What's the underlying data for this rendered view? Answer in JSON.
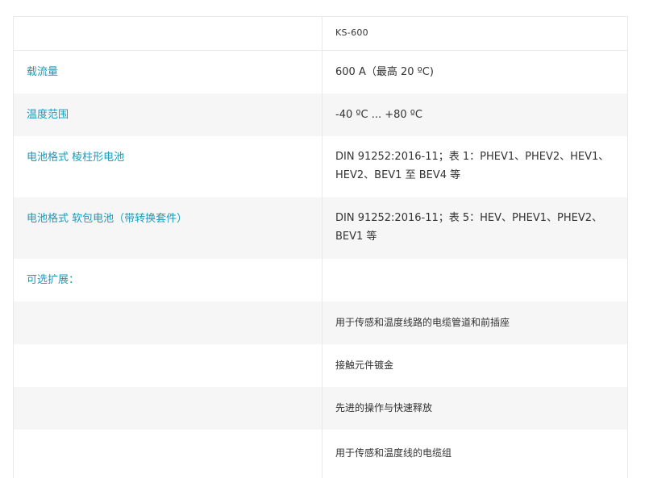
{
  "header": {
    "label": "",
    "value": "KS-600"
  },
  "rows": [
    {
      "label": "载流量",
      "value": "600 A（最高 20 ºC)"
    },
    {
      "label": "温度范围",
      "value": "-40 ºC ... +80 ºC"
    },
    {
      "label": "电池格式 棱柱形电池",
      "value": "DIN 91252:2016-11；表 1：PHEV1、PHEV2、HEV1、HEV2、BEV1 至 BEV4 等"
    },
    {
      "label": "电池格式 软包电池（带转换套件）",
      "value": "DIN 91252:2016-11；表 5：HEV、PHEV1、PHEV2、BEV1 等"
    },
    {
      "label": "可选扩展：",
      "value": ""
    },
    {
      "label": "",
      "value": "用于传感和温度线路的电缆管道和前插座"
    },
    {
      "label": "",
      "value": "接触元件镀金"
    },
    {
      "label": "",
      "value": "先进的操作与快速释放"
    },
    {
      "label": "",
      "value": "用于传感和温度线的电缆组"
    }
  ],
  "colors": {
    "label": "#1a9bb8",
    "text": "#333333",
    "stripe": "#f6f6f6",
    "border": "#e9e9e9"
  }
}
